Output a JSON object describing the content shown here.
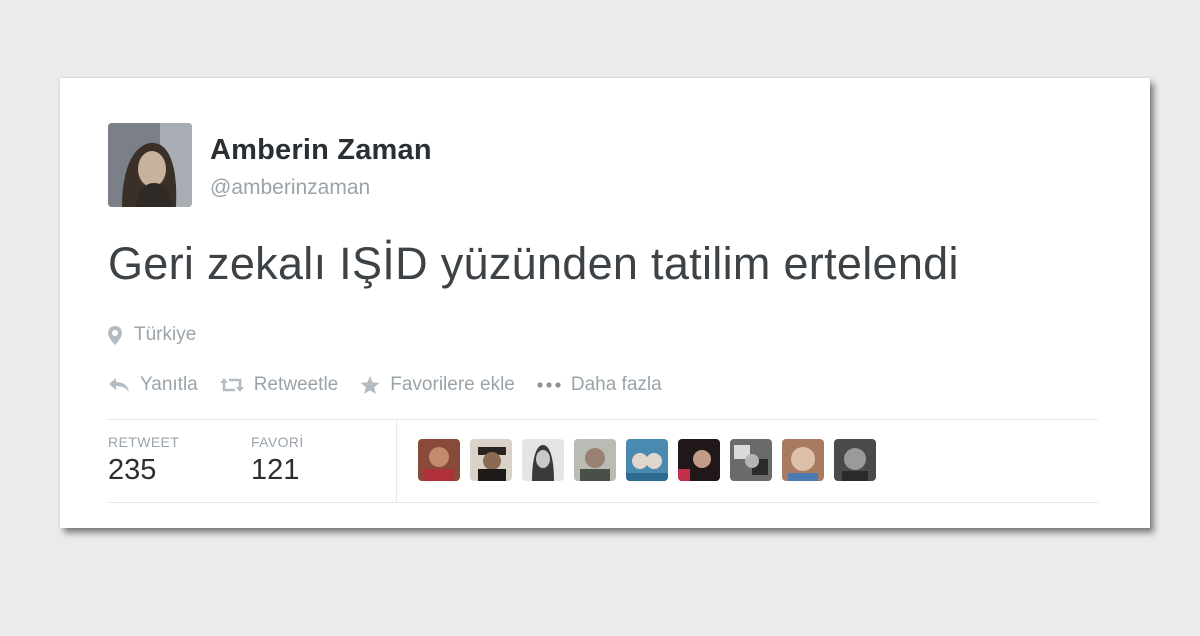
{
  "tweet": {
    "author_name": "Amberin Zaman",
    "handle": "@amberinzaman",
    "text": "Geri zekalı IŞİD yüzünden tatilim ertelendi",
    "location": "Türkiye"
  },
  "actions": [
    {
      "label": "Yanıtla",
      "icon": "reply-icon"
    },
    {
      "label": "Retweetle",
      "icon": "retweet-icon"
    },
    {
      "label": "Favorilere ekle",
      "icon": "star-icon"
    },
    {
      "label": "Daha fazla",
      "icon": "more-icon"
    }
  ],
  "stats": {
    "retweet_label": "RETWEET",
    "retweet_count": "235",
    "favorite_label": "FAVORİ",
    "favorite_count": "121"
  },
  "colors": {
    "background": "#ebebeb",
    "card": "#ffffff",
    "name": "#292f33",
    "muted": "#9aa3aa",
    "text": "#3d4246"
  }
}
